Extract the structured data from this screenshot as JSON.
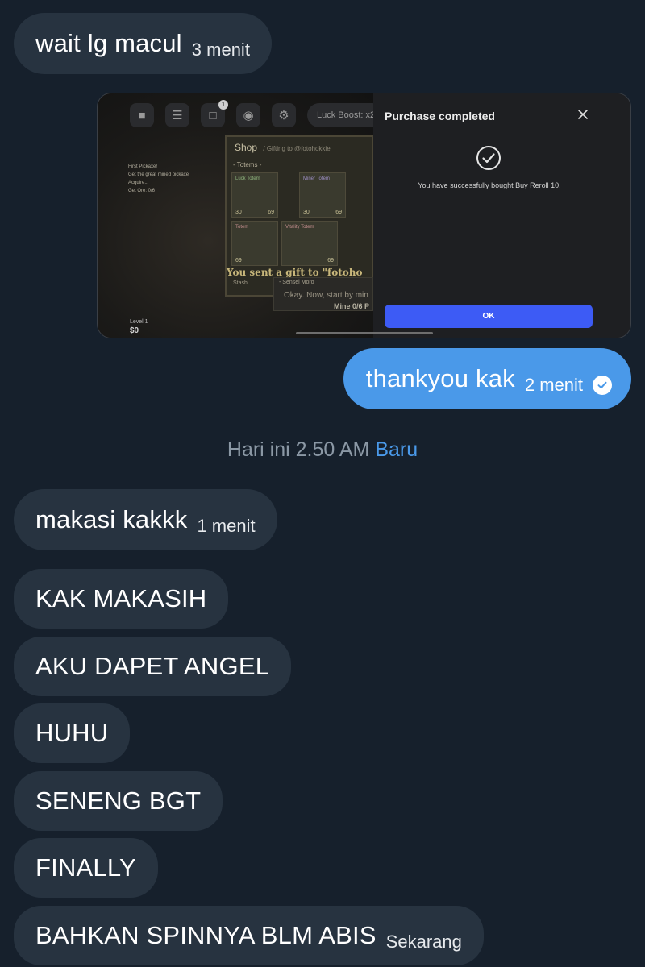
{
  "messages_top": {
    "m1": {
      "text": "wait lg macul",
      "time": "3 menit"
    }
  },
  "screenshot": {
    "game": {
      "luck_boost": "Luck Boost: x2",
      "notification_count": "1",
      "shop_title": "Shop",
      "shop_subtitle": "/ Gifting to @fotohokkie",
      "section": "- Totems -",
      "cards": [
        {
          "name": "Luck Totem",
          "price": "30"
        },
        {
          "name": "Miner Totem",
          "price": "69"
        },
        {
          "name": "Totem",
          "price": "69"
        },
        {
          "name": "Vitality Totem",
          "price": "69"
        }
      ],
      "gift_text": "You sent a gift to \"fotoho",
      "npc_name": "- Sensei Moro",
      "npc_line": "Okay. Now, start by min",
      "npc_mine": "Mine 0/6 P",
      "stash": "Stash",
      "quest": [
        "First Pickaxe!",
        "Get the great mined pickaxe",
        "Acquire...",
        "Get Ore: 0/6"
      ],
      "level": "Level 1",
      "cash": "$0"
    },
    "modal": {
      "title": "Purchase completed",
      "message": "You have successfully bought Buy Reroll 10.",
      "ok": "OK"
    }
  },
  "outgoing": {
    "text": "thankyou kak",
    "time": "2 menit"
  },
  "divider": {
    "label": "Hari ini 2.50 AM",
    "badge": "Baru"
  },
  "messages_bottom": [
    {
      "text": "makasi kakkk",
      "time": "1 menit"
    },
    {
      "text": "KAK MAKASIH"
    },
    {
      "text": "AKU DAPET ANGEL"
    },
    {
      "text": "HUHU"
    },
    {
      "text": "SENENG BGT"
    },
    {
      "text": "FINALLY"
    },
    {
      "text": "BAHKAN SPINNYA BLM ABIS",
      "time": "Sekarang"
    }
  ],
  "colors": {
    "background": "#16202c",
    "incoming_bubble": "#273340",
    "outgoing_bubble": "#4a99e9",
    "ok_button": "#3d5bf5"
  }
}
